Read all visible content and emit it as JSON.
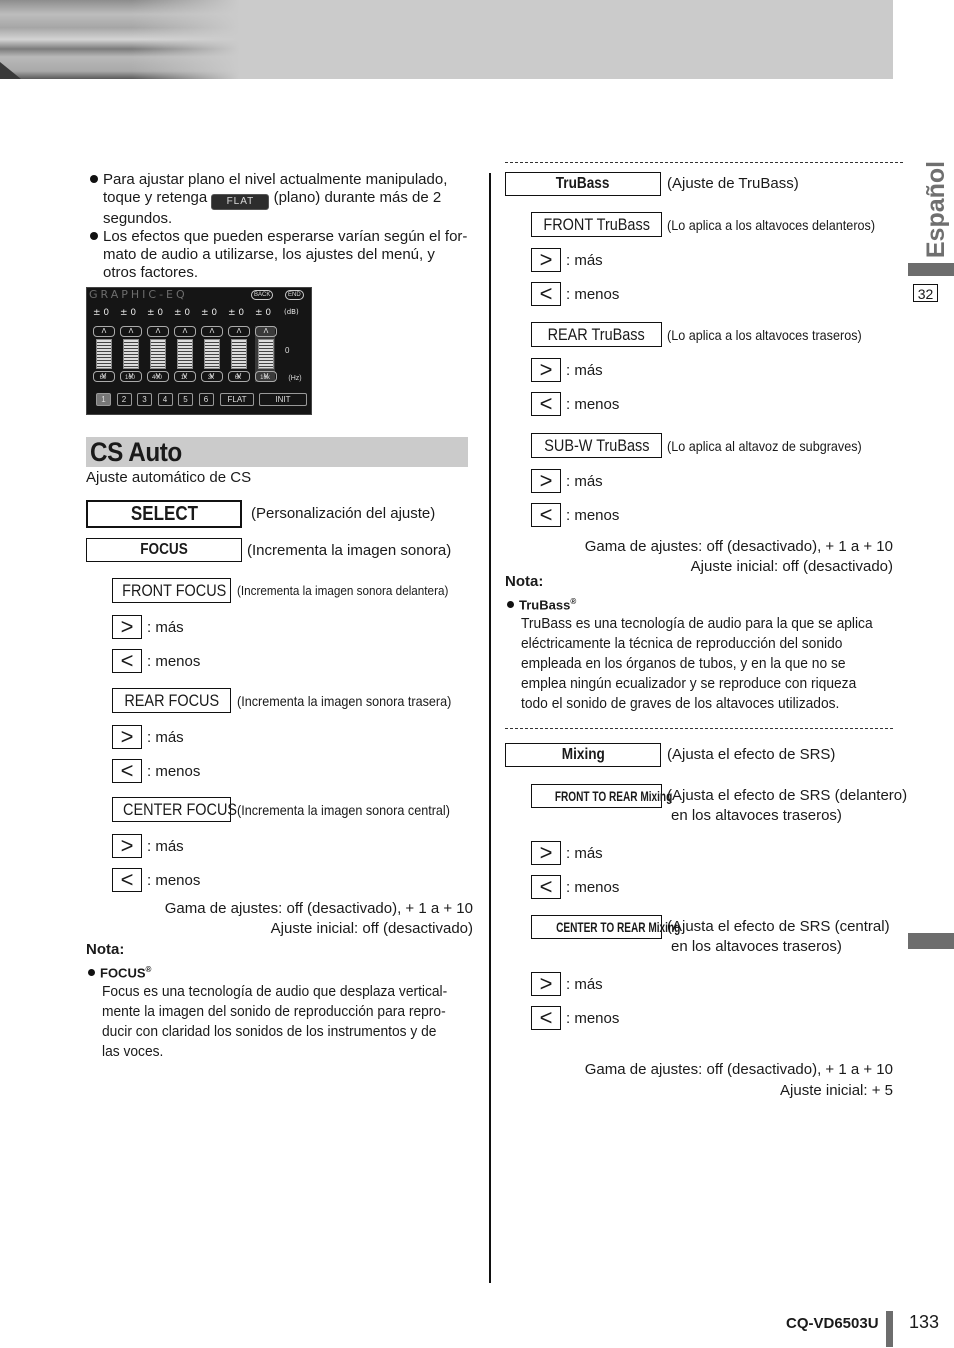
{
  "side": {
    "language": "Español",
    "section_number": "32"
  },
  "left": {
    "bullets": [
      {
        "lines": [
          "Para ajustar plano el nivel actualmente manipulado,"
        ],
        "line2_pre": "toque y retenga",
        "flat_chip": "FLAT",
        "line2_post": "(plano) durante más de 2",
        "line3": "segundos."
      },
      {
        "lines": [
          "Los efectos que pueden esperarse varían según el for-",
          "mato de audio a utilizarse, los ajustes del menú, y",
          "otros factores."
        ]
      }
    ],
    "eq_screen": {
      "title": "GRAPHIC-EQ",
      "back": "BACK",
      "end": "END",
      "band_values": [
        "± 0",
        "± 0",
        "± 0",
        "± 0",
        "± 0",
        "± 0",
        "± 0"
      ],
      "db_unit": "(dB)",
      "up_glyph": "Λ",
      "down_glyph": "V",
      "zero_label": "0",
      "frequencies": [
        "60",
        "160",
        "400",
        "1k",
        "3k",
        "6k",
        "16k"
      ],
      "hz_unit": "(Hz)",
      "presets": [
        "1",
        "2",
        "3",
        "4",
        "5",
        "6"
      ],
      "flat": "FLAT",
      "init": "INIT"
    },
    "section_title": "CS Auto",
    "section_subtitle": "Ajuste automático de CS",
    "select": {
      "label": "SELECT",
      "desc": "(Personalización del ajuste)"
    },
    "focus": {
      "label": "FOCUS",
      "desc": "(Incrementa la imagen sonora)"
    },
    "focus_items": [
      {
        "label": "FRONT FOCUS",
        "desc": "(Incrementa la imagen sonora delantera)"
      },
      {
        "label": "REAR FOCUS",
        "desc": "(Incrementa la imagen sonora trasera)"
      },
      {
        "label": "CENTER FOCUS",
        "desc": "(Incrementa la imagen sonora central)"
      }
    ],
    "range": "Gama de ajustes: off (desactivado), + 1 a + 10",
    "initial": "Ajuste inicial: off (desactivado)",
    "note_title": "Nota:",
    "note_term": "FOCUS",
    "note_reg": "®",
    "note_lines": [
      "Focus es una tecnología de audio que desplaza vertical-",
      "mente la imagen del sonido de reproducción para repro-",
      "ducir con claridad los sonidos de los instrumentos y de",
      "las voces."
    ]
  },
  "keys": {
    "more_glyph": ">",
    "less_glyph": "<",
    "more": ": más",
    "less": ": menos"
  },
  "right": {
    "trubass": {
      "label": "TruBass",
      "desc": "(Ajuste de TruBass)"
    },
    "trubass_items": [
      {
        "label": "FRONT TruBass",
        "desc": "(Lo aplica a los altavoces delanteros)"
      },
      {
        "label": "REAR TruBass",
        "desc": "(Lo aplica a los altavoces traseros)"
      },
      {
        "label": "SUB-W TruBass",
        "desc": "(Lo aplica al altavoz de subgraves)"
      }
    ],
    "trubass_range": "Gama de ajustes: off (desactivado), + 1 a + 10",
    "trubass_initial": "Ajuste inicial: off (desactivado)",
    "note_title": "Nota:",
    "note_term": "TruBass",
    "note_reg": "®",
    "note_lines": [
      "TruBass es una tecnología de audio para la que se aplica",
      "eléctricamente la técnica de reproducción del sonido",
      "empleada en los órganos de tubos, y en la que no se",
      "emplea ningún ecualizador y se reproduce con riqueza",
      "todo el sonido de graves de los altavoces utilizados."
    ],
    "mixing": {
      "label": "Mixing",
      "desc": "(Ajusta el efecto de SRS)"
    },
    "mixing_items": [
      {
        "label": "FRONT TO REAR Mixing",
        "desc1": "(Ajusta el efecto de SRS (delantero)",
        "desc2": "en los altavoces traseros)"
      },
      {
        "label": "CENTER TO REAR Mixing",
        "desc1": "(Ajusta el efecto de SRS (central)",
        "desc2": "en los altavoces traseros)"
      }
    ],
    "mixing_range": "Gama de ajustes: off (desactivado), + 1 a + 10",
    "mixing_initial": "Ajuste inicial: + 5"
  },
  "footer": {
    "model": "CQ-VD6503U",
    "page": "133"
  }
}
